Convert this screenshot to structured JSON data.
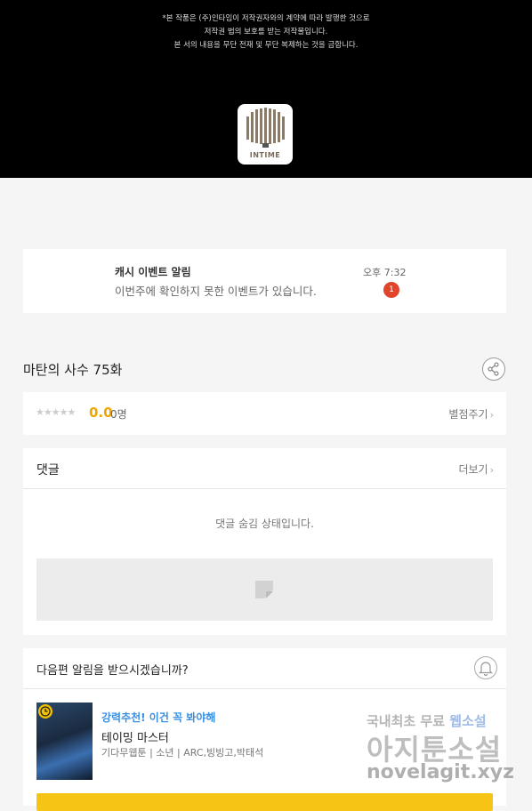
{
  "notice": {
    "line1": "*본 작품은 (주)인타임이 저작권자와의 계약에 따라 발행한 것으로",
    "line2": "저작권 법의 보호를 받는 저작물입니다.",
    "line3": "본 서의 내용을 무단 전재 및 무단 복제하는 것을 금합니다."
  },
  "logo": {
    "text": "INTIME"
  },
  "alarm": {
    "title": "캐시 이벤트 알림",
    "message": "이번주에 확인하지 못한 이벤트가 있습니다.",
    "time": "오후 7:32",
    "badge": "1"
  },
  "episode": {
    "title": "마탄의 사수 75화"
  },
  "rating": {
    "stars": "★★★★★",
    "score": "0.0",
    "people": "0명",
    "give_label": "별점주기"
  },
  "comments": {
    "title": "댓글",
    "more_label": "더보기",
    "hidden_text": "댓글 숨김 상태입니다."
  },
  "next_alert": {
    "question": "다음편 알림을 받으시겠습니까?"
  },
  "recommendation": {
    "tagline": "강력추천! 이건 꼭 봐야해",
    "title": "테이밍 마스터",
    "meta": "기다무웹툰 | 소년 | ARC,빙빙고,박태석"
  },
  "watermark": {
    "line1_a": "국내최초 무료",
    "line1_b": "웹소설",
    "line2": "아지툰소설",
    "line3": "novelagit.xyz"
  },
  "colors": {
    "badge": "#e0452c",
    "score": "#f0a500",
    "recommend": "#3a8fe0",
    "button": "#f6c414"
  }
}
